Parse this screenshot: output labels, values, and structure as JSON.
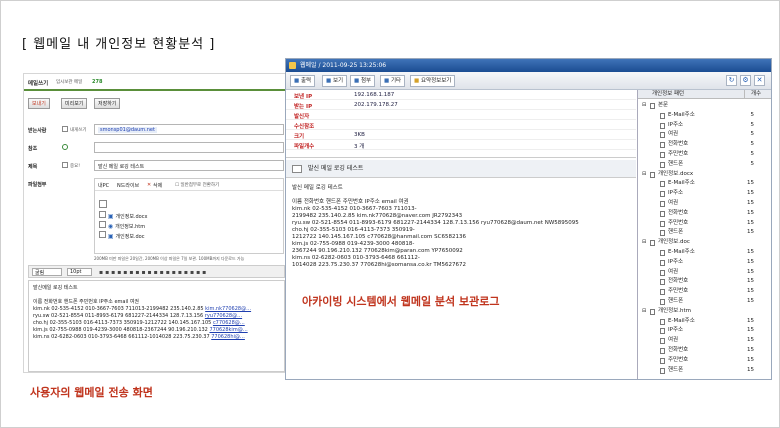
{
  "heading": "[ 웹메일 내 개인정보 현황분석 ]",
  "mail": {
    "title": "메일쓰기",
    "saved_info": "임시보관 메일",
    "saved_count": "278",
    "buttons": [
      "보내기",
      "미리보기",
      "저장하기"
    ],
    "to_label": "받는사람",
    "self_label": "내게쓰기",
    "to_value": "smonsp01@daum.net",
    "cc_label": "참조",
    "subject_label": "제목",
    "important_label": "중요!",
    "subject_value": "발신 메일 로깅 테스트",
    "attach_label": "파일첨부",
    "attach_tabs": [
      "내PC",
      "N드라이브"
    ],
    "attach_delete": "삭제",
    "attach_note": "☐ 일반첨부로 전환하기",
    "files": [
      "개인정보.docx",
      "개인정보.htm",
      "개인정보.doc"
    ],
    "size_note": "200MB 미만 파일은 20일간, 200MB 이상 파일은 7일 보관. 100MB까지 다운로드 가능",
    "font_select": "굴림",
    "size_select": "10pt",
    "body_lines": [
      "발신메일 로깅 테스트",
      "",
      "이름 전화번호 핸드폰 주민번호 IP주소 email 여권",
      "kim.nk 02-535-4152 010-3667-7603 711013-2199482 235.140.2.85",
      "ryu.sw 02-521-8554 011-8993-6179 681227-2144334 128.7.13.156",
      "cho.hj 02-355-5103 016-4113-7373 350919-1212722 140.145.167.105",
      "kim.js 02-755-0988 019-4239-3000 480818-2367244 90.196.210.132",
      "kim.ns 02-6282-0603 010-3793-6468 661112-1014028 223.75.230.37"
    ],
    "body_links": [
      "kim.nk770628@…",
      "ryu770628@…",
      "c770628@…",
      "770628kim@…",
      "770628hi@…"
    ]
  },
  "annotation_user": "사용자의 웹메일 전송 화면",
  "annotation_archive": "아카이빙 시스템에서 웹메일 분석 보관로그",
  "archive": {
    "title": "웹메일 / 2011-09-25 13:25:06",
    "toolbar": [
      "출력",
      "보기",
      "첨부",
      "기타",
      "요약정보보기"
    ],
    "props": [
      {
        "k": "보낸 IP",
        "v": "192.168.1.187"
      },
      {
        "k": "받는 IP",
        "v": "202.179.178.27"
      },
      {
        "k": "발신자",
        "v": ""
      },
      {
        "k": "수신참조",
        "v": ""
      },
      {
        "k": "크기",
        "v": "3KB"
      },
      {
        "k": "파일개수",
        "v": "3 개"
      }
    ],
    "subject": "발신 메일 로깅 테스트",
    "body_lines": [
      "발신 메일 로깅 테스트",
      "",
      "이름 전화번호 핸드폰 주민번호 IP주소 email 여권",
      "kim.nk 02-535-4152 010-3667-7603 711013-",
      "2199482 235.140.2.85 kim.nk770628@naver.com JR2792343",
      "ryu.sw 02-521-8554 011-8993-6179 681227-2144334 128.7.13.156 ryu770628@daum.net NW5895095",
      "cho.hj 02-355-5103 016-4113-7373 350919-",
      "1212722 140.145.167.105 c770628@hanmail.com SC6582136",
      "kim.js 02-755-0988 019-4239-3000 480818-",
      "2367244 90.196.210.132 770628kim@paran.com YP7650092",
      "kim.ns 02-6282-0603 010-3793-6468 661112-",
      "1014028 223.75.230.37 770628hi@somansa.co.kr TM5627672"
    ],
    "tree_headers": [
      "개인정보 패턴",
      "개수"
    ],
    "tree": [
      {
        "l": "본문",
        "c": "",
        "lvl": 0
      },
      {
        "l": "E-Mail주소",
        "c": "5",
        "lvl": 1
      },
      {
        "l": "IP주소",
        "c": "5",
        "lvl": 1
      },
      {
        "l": "여권",
        "c": "5",
        "lvl": 1
      },
      {
        "l": "전화번호",
        "c": "5",
        "lvl": 1
      },
      {
        "l": "주민번호",
        "c": "5",
        "lvl": 1
      },
      {
        "l": "핸드폰",
        "c": "5",
        "lvl": 1
      },
      {
        "l": "개인정보.docx",
        "c": "",
        "lvl": 0
      },
      {
        "l": "E-Mail주소",
        "c": "15",
        "lvl": 1
      },
      {
        "l": "IP주소",
        "c": "15",
        "lvl": 1
      },
      {
        "l": "여권",
        "c": "15",
        "lvl": 1
      },
      {
        "l": "전화번호",
        "c": "15",
        "lvl": 1
      },
      {
        "l": "주민번호",
        "c": "15",
        "lvl": 1
      },
      {
        "l": "핸드폰",
        "c": "15",
        "lvl": 1
      },
      {
        "l": "개인정보.doc",
        "c": "",
        "lvl": 0
      },
      {
        "l": "E-Mail주소",
        "c": "15",
        "lvl": 1
      },
      {
        "l": "IP주소",
        "c": "15",
        "lvl": 1
      },
      {
        "l": "여권",
        "c": "15",
        "lvl": 1
      },
      {
        "l": "전화번호",
        "c": "15",
        "lvl": 1
      },
      {
        "l": "주민번호",
        "c": "15",
        "lvl": 1
      },
      {
        "l": "핸드폰",
        "c": "15",
        "lvl": 1
      },
      {
        "l": "개인정보.htm",
        "c": "",
        "lvl": 0
      },
      {
        "l": "E-Mail주소",
        "c": "15",
        "lvl": 1
      },
      {
        "l": "IP주소",
        "c": "15",
        "lvl": 1
      },
      {
        "l": "여권",
        "c": "15",
        "lvl": 1
      },
      {
        "l": "전화번호",
        "c": "15",
        "lvl": 1
      },
      {
        "l": "주민번호",
        "c": "15",
        "lvl": 1
      },
      {
        "l": "핸드폰",
        "c": "15",
        "lvl": 1
      }
    ]
  },
  "colors": {
    "accent": "#c0341d",
    "titlebar": "#1b4c92",
    "link": "#1f3fb0"
  }
}
